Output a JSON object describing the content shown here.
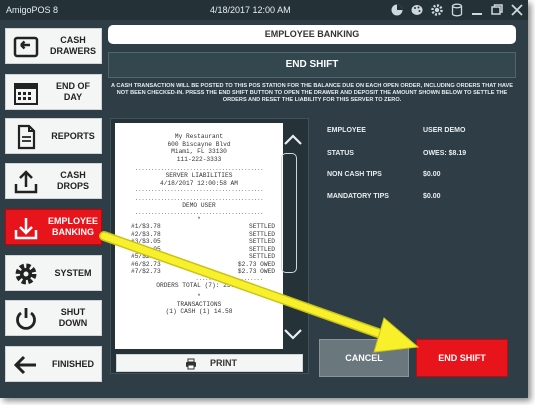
{
  "app": {
    "title": "AmigoPOS 8",
    "datetime": "4/18/2017 12:00 AM",
    "titlebar_icons": [
      "pie-chart-icon",
      "palette-icon",
      "gear-icon",
      "database-icon",
      "minimize-icon",
      "restore-icon",
      "close-icon"
    ]
  },
  "sidebar": {
    "items": [
      {
        "label": "CASH\nDRAWERS",
        "icon": "cash-drawer-icon",
        "active": false
      },
      {
        "label": "END OF\nDAY",
        "icon": "calendar-icon",
        "active": false
      },
      {
        "label": "REPORTS",
        "icon": "document-icon",
        "active": false
      },
      {
        "label": "CASH\nDROPS",
        "icon": "upload-tray-icon",
        "active": false
      },
      {
        "label": "EMPLOYEE\nBANKING",
        "icon": "download-tray-icon",
        "active": true
      },
      {
        "label": "SYSTEM",
        "icon": "gear-icon",
        "active": false
      },
      {
        "label": "SHUT\nDOWN",
        "icon": "power-icon",
        "active": false
      },
      {
        "label": "FINISHED",
        "icon": "arrow-left-icon",
        "active": false
      }
    ]
  },
  "main": {
    "header_title": "EMPLOYEE BANKING",
    "section_title": "END SHIFT",
    "notice": "A CASH TRANSACTION WILL BE POSTED TO THIS POS STATION FOR THE BALANCE DUE ON EACH OPEN ORDER, INCLUDING ORDERS THAT HAVE NOT BEEN CHECKED-IN. PRESS THE END SHIFT BUTTON TO OPEN THE DRAWER AND DEPOSIT THE AMOUNT SHOWN BELOW TO SETTLE THE ORDERS AND RESET THE LIABILITY FOR THIS SERVER TO ZERO."
  },
  "receipt": {
    "restaurant": "My Restaurant",
    "address1": "600 Biscayne Blvd",
    "address2": "Miami, FL 33130",
    "phone": "111-222-3333",
    "heading": "SERVER LIABILITIES",
    "timestamp": "4/18/2017 12:00:58 AM",
    "server": "DEMO USER",
    "star": "*",
    "rows": [
      {
        "order": "#1/$3.78",
        "status": "SETTLED"
      },
      {
        "order": "#2/$3.78",
        "status": "SETTLED"
      },
      {
        "order": "#3/$3.05",
        "status": "SETTLED"
      },
      {
        "order": "#4/$3.05",
        "status": "SETTLED"
      },
      {
        "order": "#5/$2.73",
        "status": "SETTLED"
      },
      {
        "order": "#6/$2.73",
        "status": "$2.73 OWED"
      },
      {
        "order": "#7/$2.73",
        "status": "$2.73 OWED"
      }
    ],
    "orders_total": "ORDERS TOTAL (7):  23.12",
    "star2": "*",
    "transactions": "TRANSACTIONS",
    "last_line": "(1) CASH (1)         14.58",
    "print_label": "PRINT"
  },
  "info": {
    "employee_label": "EMPLOYEE",
    "employee_value": "USER DEMO",
    "status_label": "STATUS",
    "status_value": "OWES: $8.19",
    "noncash_label": "NON CASH TIPS",
    "noncash_value": "$0.00",
    "mandatory_label": "MANDATORY TIPS",
    "mandatory_value": "$0.00"
  },
  "actions": {
    "cancel_label": "CANCEL",
    "end_shift_label": "END SHIFT"
  },
  "colors": {
    "background": "#2f3e46",
    "accent_red": "#e8141c",
    "arrow_yellow": "#f7f02b"
  }
}
